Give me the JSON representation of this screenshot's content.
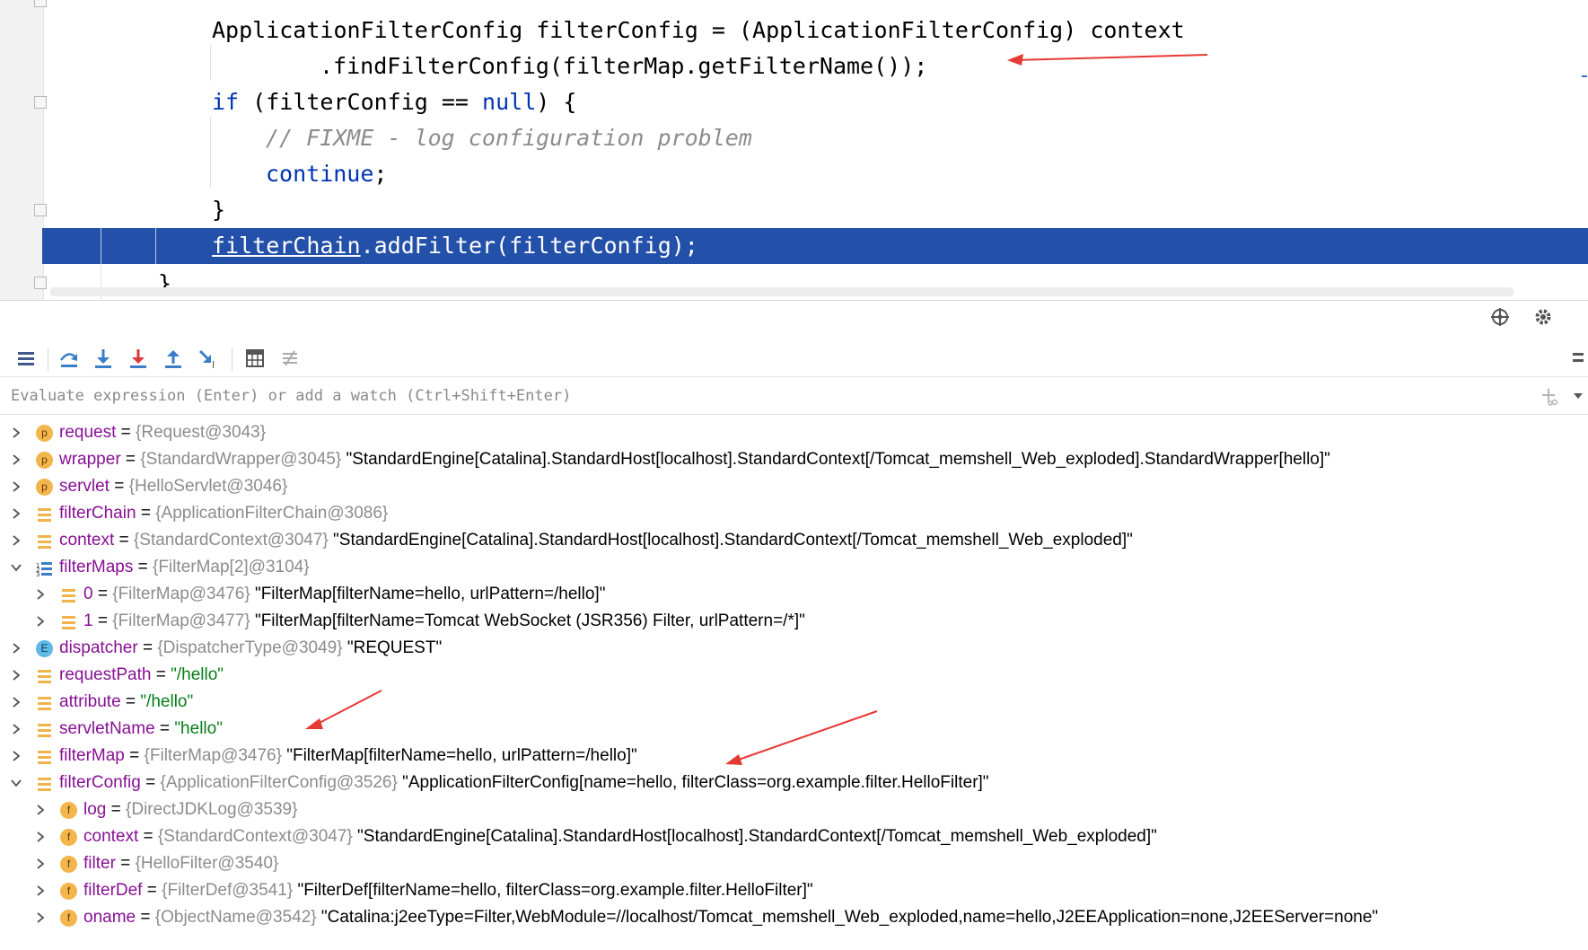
{
  "editor": {
    "lines": [
      {
        "text": "ApplicationFilterConfig filterConfig = (ApplicationFilterConfig) context"
      },
      {
        "text": ".findFilterConfig(filterMap.getFilterName());"
      },
      {
        "kw": "if",
        "rest": " (filterConfig == ",
        "kw2": "null",
        "rest2": ") {"
      },
      {
        "comment": "// FIXME - log configuration problem"
      },
      {
        "kw": "continue",
        "rest": ";"
      },
      {
        "text": "}"
      },
      {
        "ul": "filterChain",
        "rest": ".addFilter(filterConfig);"
      },
      {
        "text": "}"
      }
    ],
    "highlight_color": "#2350a8"
  },
  "debugger": {
    "toolbar_icons": [
      "frames-menu-icon",
      "step-over-icon",
      "step-into-icon",
      "force-step-into-icon",
      "step-out-icon",
      "run-to-cursor-icon",
      "evaluate-expression-icon",
      "trace-current-stream-icon"
    ],
    "top_right_icons": [
      "crosshair-icon",
      "gear-icon"
    ],
    "eval_placeholder": "Evaluate expression (Enter) or add a watch (Ctrl+Shift+Enter)",
    "variables": [
      {
        "name": "request",
        "eq": " = ",
        "type": "{Request@3043}",
        "desc": "",
        "icon": "p"
      },
      {
        "name": "wrapper",
        "eq": " = ",
        "type": "{StandardWrapper@3045}",
        "desc": " \"StandardEngine[Catalina].StandardHost[localhost].StandardContext[/Tomcat_memshell_Web_exploded].StandardWrapper[hello]\"",
        "icon": "p"
      },
      {
        "name": "servlet",
        "eq": " = ",
        "type": "{HelloServlet@3046}",
        "desc": "",
        "icon": "p"
      },
      {
        "name": "filterChain",
        "eq": " = ",
        "type": "{ApplicationFilterChain@3086}",
        "desc": "",
        "icon": "field"
      },
      {
        "name": "context",
        "eq": " = ",
        "type": "{StandardContext@3047}",
        "desc": " \"StandardEngine[Catalina].StandardHost[localhost].StandardContext[/Tomcat_memshell_Web_exploded]\"",
        "icon": "field"
      },
      {
        "name": "filterMaps",
        "eq": " = ",
        "type": "{FilterMap[2]@3104}",
        "desc": "",
        "icon": "array"
      },
      {
        "name": "0",
        "eq": " = ",
        "type": "{FilterMap@3476}",
        "desc": " \"FilterMap[filterName=hello, urlPattern=/hello]\"",
        "icon": "field"
      },
      {
        "name": "1",
        "eq": " = ",
        "type": "{FilterMap@3477}",
        "desc": " \"FilterMap[filterName=Tomcat WebSocket (JSR356) Filter, urlPattern=/*]\"",
        "icon": "field"
      },
      {
        "name": "dispatcher",
        "eq": " = ",
        "type": "{DispatcherType@3049}",
        "desc": " \"REQUEST\"",
        "icon": "e"
      },
      {
        "name": "requestPath",
        "eq": " = ",
        "str": "\"/hello\"",
        "icon": "field"
      },
      {
        "name": "attribute",
        "eq": " = ",
        "str": "\"/hello\"",
        "icon": "field"
      },
      {
        "name": "servletName",
        "eq": " = ",
        "str": "\"hello\"",
        "icon": "field"
      },
      {
        "name": "filterMap",
        "eq": " = ",
        "type": "{FilterMap@3476}",
        "desc": " \"FilterMap[filterName=hello, urlPattern=/hello]\"",
        "icon": "field"
      },
      {
        "name": "filterConfig",
        "eq": " = ",
        "type": "{ApplicationFilterConfig@3526}",
        "desc": " \"ApplicationFilterConfig[name=hello, filterClass=org.example.filter.HelloFilter]\"",
        "icon": "field"
      },
      {
        "name": "log",
        "eq": " = ",
        "type": "{DirectJDKLog@3539}",
        "desc": "",
        "icon": "f"
      },
      {
        "name": "context",
        "eq": " = ",
        "type": "{StandardContext@3047}",
        "desc": " \"StandardEngine[Catalina].StandardHost[localhost].StandardContext[/Tomcat_memshell_Web_exploded]\"",
        "icon": "f"
      },
      {
        "name": "filter",
        "eq": " = ",
        "type": "{HelloFilter@3540}",
        "desc": "",
        "icon": "f"
      },
      {
        "name": "filterDef",
        "eq": " = ",
        "type": "{FilterDef@3541}",
        "desc": " \"FilterDef[filterName=hello, filterClass=org.example.filter.HelloFilter]\"",
        "icon": "f"
      },
      {
        "name": "oname",
        "eq": " = ",
        "type": "{ObjectName@3542}",
        "desc": " \"Catalina:j2eeType=Filter,WebModule=//localhost/Tomcat_memshell_Web_exploded,name=hello,J2EEApplication=none,J2EEServer=none\"",
        "icon": "f"
      }
    ]
  },
  "annotation_color": "#e53935"
}
